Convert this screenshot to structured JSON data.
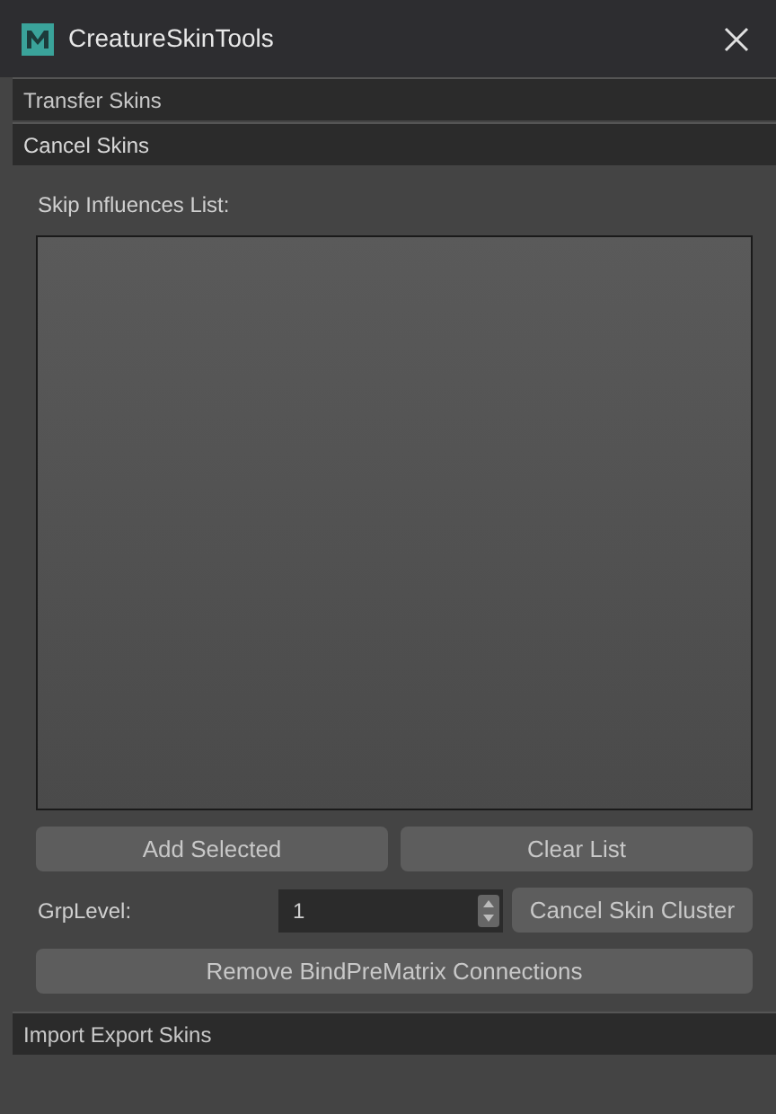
{
  "window": {
    "title": "CreatureSkinTools"
  },
  "sections": [
    {
      "label": "Transfer Skins",
      "expanded": false
    },
    {
      "label": "Cancel Skins",
      "expanded": true,
      "content": {
        "list_label": "Skip Influences List:",
        "buttons": [
          "Add Selected",
          "Clear List"
        ],
        "grp_level": {
          "label": "GrpLevel:",
          "value": "1"
        },
        "cancel_button": "Cancel Skin Cluster",
        "remove_button": "Remove BindPreMatrix Connections"
      }
    },
    {
      "label": "Import Export Skins",
      "expanded": false
    }
  ]
}
